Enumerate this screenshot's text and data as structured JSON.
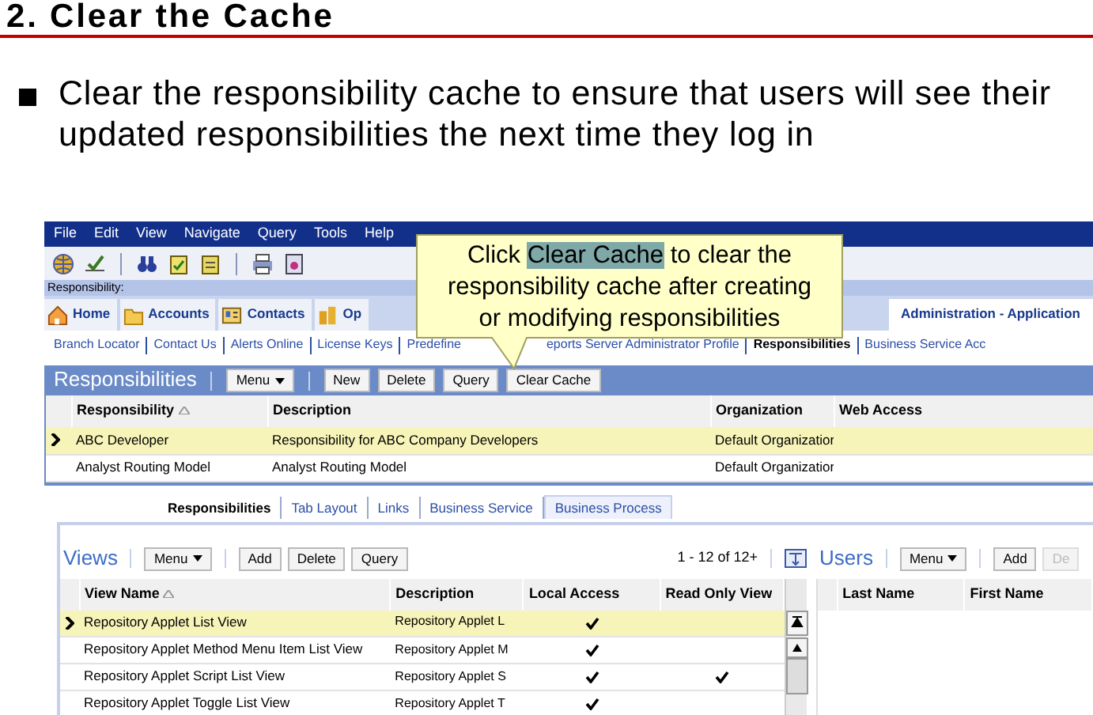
{
  "slide": {
    "title": "2. Clear the Cache",
    "bullets": [
      "Clear the responsibility cache to ensure that users will see their updated responsibilities the next time they log in"
    ]
  },
  "app": {
    "menu": [
      "File",
      "Edit",
      "View",
      "Navigate",
      "Query",
      "Tools",
      "Help"
    ],
    "screen_label": "Responsibility:",
    "tabs": [
      {
        "label": "Home",
        "selected": false
      },
      {
        "label": "Accounts",
        "selected": false
      },
      {
        "label": "Contacts",
        "selected": false
      },
      {
        "label": "Op",
        "selected": false
      },
      {
        "label": "Administration - Application",
        "selected": true
      }
    ],
    "links": [
      {
        "label": "Branch Locator",
        "selected": false
      },
      {
        "label": "Contact Us",
        "selected": false
      },
      {
        "label": "Alerts Online",
        "selected": false
      },
      {
        "label": "License Keys",
        "selected": false
      },
      {
        "label": "Predefine",
        "selected": false
      },
      {
        "label": "eports Server Administrator Profile",
        "selected": false
      },
      {
        "label": "Responsibilities",
        "selected": true
      },
      {
        "label": "Business Service Acc",
        "selected": false
      }
    ],
    "applet": {
      "title": "Responsibilities",
      "buttons": [
        {
          "label": "Menu",
          "kind": "menu"
        },
        {
          "label": "New",
          "kind": "button"
        },
        {
          "label": "Delete",
          "kind": "button"
        },
        {
          "label": "Query",
          "kind": "button"
        },
        {
          "label": "Clear Cache",
          "kind": "button"
        }
      ],
      "columns": [
        "Responsibility",
        "Description",
        "Organization",
        "Web Access"
      ],
      "rows": [
        {
          "selected": true,
          "cells": [
            "ABC Developer",
            "Responsibility for ABC Company Developers",
            "Default Organizatior",
            ""
          ]
        },
        {
          "selected": false,
          "cells": [
            "Analyst Routing Model",
            "Analyst Routing Model",
            "Default Organizatior",
            ""
          ]
        }
      ]
    },
    "subtabs": [
      {
        "label": "Responsibilities",
        "selected": true
      },
      {
        "label": "Tab Layout",
        "selected": false
      },
      {
        "label": "Links",
        "selected": false
      },
      {
        "label": "Business Service",
        "selected": false
      },
      {
        "label": "Business Process",
        "selected": false
      }
    ],
    "views": {
      "title": "Views",
      "buttons": [
        {
          "label": "Menu",
          "kind": "menu"
        },
        {
          "label": "Add",
          "kind": "button"
        },
        {
          "label": "Delete",
          "kind": "button"
        },
        {
          "label": "Query",
          "kind": "button"
        }
      ],
      "count": "1 - 12 of 12+",
      "columns": [
        "View Name",
        "Description",
        "Local Access",
        "Read Only View"
      ],
      "rows": [
        {
          "selected": true,
          "name": "Repository Applet List View",
          "description": "Repository Applet L",
          "local_access": true,
          "read_only": false
        },
        {
          "selected": false,
          "name": "Repository Applet Method Menu Item List View",
          "description": "Repository Applet M",
          "local_access": true,
          "read_only": false
        },
        {
          "selected": false,
          "name": "Repository Applet Script List View",
          "description": "Repository Applet S",
          "local_access": true,
          "read_only": true
        },
        {
          "selected": false,
          "name": "Repository Applet Toggle List View",
          "description": "Repository Applet T",
          "local_access": true,
          "read_only": false
        }
      ]
    },
    "users": {
      "title": "Users",
      "buttons": [
        {
          "label": "Menu",
          "kind": "menu",
          "disabled": false
        },
        {
          "label": "Add",
          "kind": "button",
          "disabled": false
        },
        {
          "label": "De",
          "kind": "button",
          "disabled": true
        }
      ],
      "columns": [
        "Last Name",
        "First Name"
      ]
    },
    "callout": {
      "before": "Click",
      "highlight": "Clear Cache",
      "after": "to clear the responsibility cache after creating or modifying responsibilities"
    }
  }
}
